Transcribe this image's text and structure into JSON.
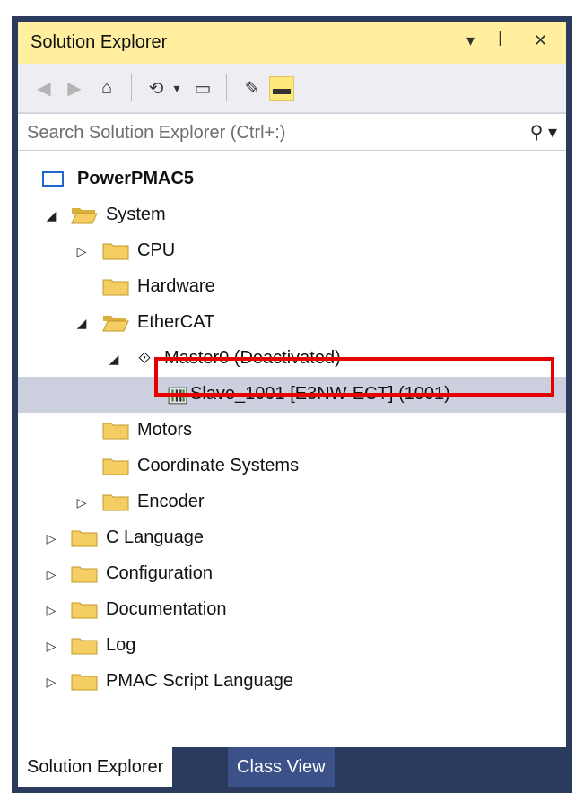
{
  "header": {
    "title": "Solution Explorer",
    "dropdown_glyph": "▾",
    "pin_glyph": "ꟾ",
    "close_glyph": "✕"
  },
  "search": {
    "placeholder": "Search Solution Explorer (Ctrl+:)"
  },
  "toolbar": {
    "back_glyph": "◀",
    "forward_glyph": "▶",
    "home_glyph": "⌂",
    "history_glyph": "⟲",
    "dropdown_glyph": "▾",
    "collapse_glyph": "▭",
    "wrench_glyph": "✎",
    "pin_active_glyph": "▬"
  },
  "tree": {
    "root": "PowerPMAC5",
    "items": [
      {
        "label": "System"
      },
      {
        "label": "CPU"
      },
      {
        "label": "Hardware"
      },
      {
        "label": "EtherCAT"
      },
      {
        "label": "Master0 (Deactivated)"
      },
      {
        "label": "Slave_1001 [E3NW-ECT] (1001)"
      },
      {
        "label": "Motors"
      },
      {
        "label": "Coordinate Systems"
      },
      {
        "label": "Encoder"
      },
      {
        "label": "C Language"
      },
      {
        "label": "Configuration"
      },
      {
        "label": "Documentation"
      },
      {
        "label": "Log"
      },
      {
        "label": "PMAC Script Language"
      }
    ]
  },
  "tabs": [
    {
      "label": "Solution Explorer"
    },
    {
      "label": "Class View"
    }
  ],
  "colors": {
    "title_bar": "#ffef9f",
    "frame": "#2b3b5e",
    "selected_row": "#ccd0de",
    "highlight_box": "#e60000",
    "inactive_tab": "#3c5188"
  }
}
